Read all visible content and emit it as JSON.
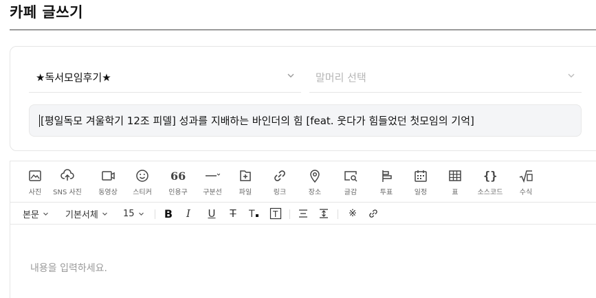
{
  "page": {
    "title": "카페 글쓰기"
  },
  "form": {
    "board_select": {
      "value": "★독서모임후기★",
      "icon": "chevron-down-icon"
    },
    "header_select": {
      "placeholder": "말머리 선택",
      "icon": "chevron-down-icon"
    },
    "title_input": {
      "value": "[평일독모 겨울학기 12조 피델] 성과를 지배하는 바인더의 힘 [feat. 웃다가 힘들었던 첫모임의 기억]"
    }
  },
  "toolbar": {
    "items": [
      {
        "label": "사진",
        "icon": "photo-icon"
      },
      {
        "label": "SNS 사진",
        "icon": "cloud-upload-icon"
      },
      {
        "label": "동영상",
        "icon": "video-icon"
      },
      {
        "label": "스티커",
        "icon": "smiley-icon"
      },
      {
        "label": "인용구",
        "icon": "quote-icon"
      },
      {
        "label": "구분선",
        "icon": "divider-icon"
      },
      {
        "label": "파일",
        "icon": "file-plus-icon"
      },
      {
        "label": "링크",
        "icon": "link-icon"
      },
      {
        "label": "장소",
        "icon": "location-pin-icon"
      },
      {
        "label": "글감",
        "icon": "search-doc-icon"
      },
      {
        "label": "투표",
        "icon": "poll-icon"
      },
      {
        "label": "일정",
        "icon": "calendar-icon"
      },
      {
        "label": "표",
        "icon": "table-icon"
      },
      {
        "label": "소스코드",
        "icon": "code-braces-icon"
      },
      {
        "label": "수식",
        "icon": "sqrt-icon"
      }
    ]
  },
  "format_bar": {
    "paragraph_style": "본문",
    "font_family": "기본서체",
    "font_size": "15"
  },
  "editor": {
    "placeholder": "내용을 입력하세요."
  }
}
